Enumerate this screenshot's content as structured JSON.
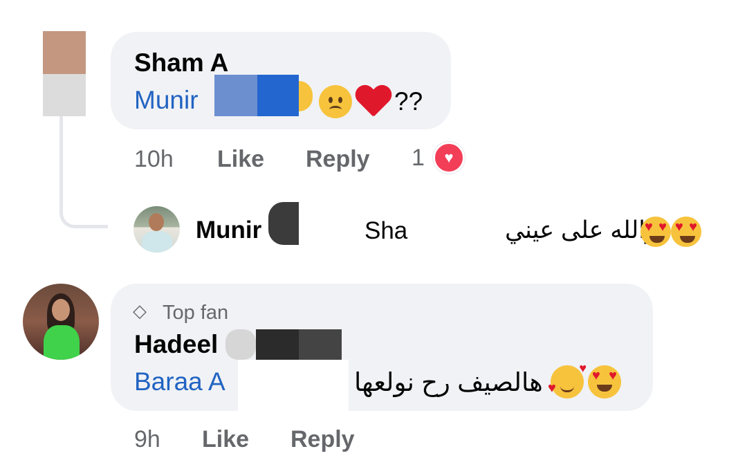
{
  "comments": [
    {
      "author": "Sham A",
      "mention": "Munir",
      "suffix": "??",
      "time": "10h",
      "like_label": "Like",
      "reply_label": "Reply",
      "reaction_count": "1",
      "reply": {
        "author": "Munir",
        "mention_partial": "Shar",
        "text": "والله على عيني"
      }
    },
    {
      "badge": "Top fan",
      "author": "Hadeel",
      "mention": "Baraa A",
      "text": "هالصيف رح نولعها",
      "time": "9h",
      "like_label": "Like",
      "reply_label": "Reply"
    }
  ],
  "icons": {
    "badge_icon": "diamond-icon",
    "reaction_icon": "heart-icon"
  },
  "colors": {
    "bubble": "#f0f2f5",
    "mention": "#2163c2",
    "meta": "#65676b",
    "reaction": "#f33e58"
  }
}
